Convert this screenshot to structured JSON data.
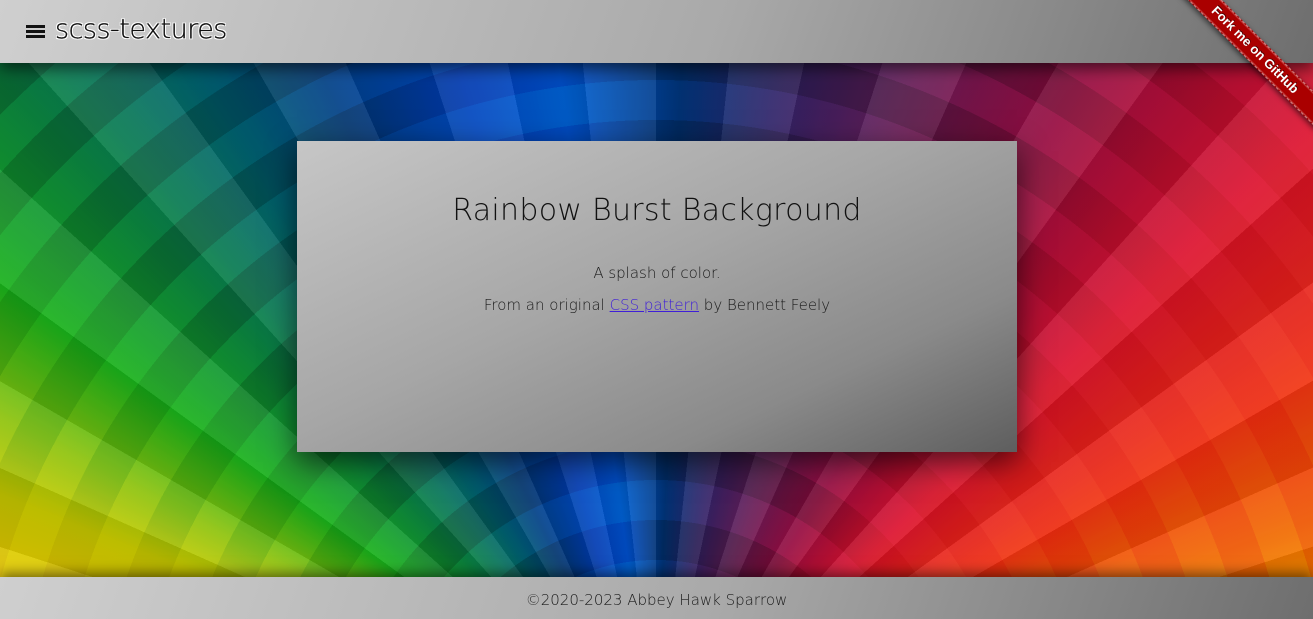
{
  "header": {
    "brand": "scss-textures",
    "menu_icon": "hamburger-menu-icon"
  },
  "ribbon": {
    "label": "Fork me on GitHub",
    "color": "#aa0000"
  },
  "card": {
    "title": "Rainbow Burst Background",
    "subtitle": "A splash of color.",
    "credit_prefix": "From an original",
    "credit_link": "CSS pattern",
    "credit_suffix": "by Bennett Feely"
  },
  "footer": {
    "copyright": "©2020-2023 Abbey Hawk Sparrow"
  },
  "colors": {
    "link": "#3f1fd8",
    "background_palette": [
      "#ffd400",
      "#16a818",
      "#005a66",
      "#0040b8",
      "#5a1a50",
      "#d8102a",
      "#f06000"
    ]
  }
}
